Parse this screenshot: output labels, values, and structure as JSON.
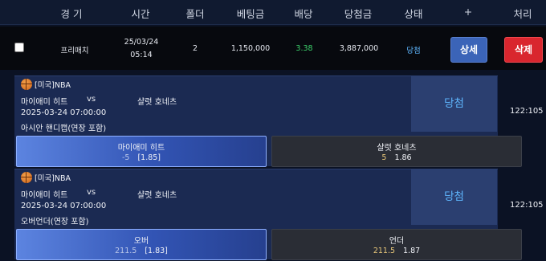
{
  "header": {
    "col_game": "경 기",
    "col_time": "시간",
    "col_folder": "폴더",
    "col_stake": "베팅금",
    "col_odds": "배당",
    "col_payout": "당첨금",
    "col_status": "상태",
    "col_plus": "+",
    "col_action": "처리"
  },
  "summary": {
    "game_type": "프리매치",
    "date": "25/03/24",
    "time": "05:14",
    "folder": "2",
    "stake": "1,150,000",
    "odds": "3.38",
    "payout": "3,887,000",
    "status": "당첨",
    "detail_button": "상세",
    "delete_button": "삭제"
  },
  "bets": [
    {
      "league": "[미국]NBA",
      "home": "마이애미 히트",
      "vs": "vs",
      "away": "샬럿 호네츠",
      "datetime": "2025-03-24 07:00:00",
      "market": "아시안 핸디캡(연장 포함)",
      "result": "당첨",
      "score": "122:105",
      "options": [
        {
          "name": "마이애미 히트",
          "line": "-5",
          "odds": "[1.85]",
          "selected": true
        },
        {
          "name": "샬럿 호네츠",
          "line": "5",
          "odds": "1.86",
          "selected": false
        }
      ]
    },
    {
      "league": "[미국]NBA",
      "home": "마이애미 히트",
      "vs": "vs",
      "away": "샬럿 호네츠",
      "datetime": "2025-03-24 07:00:00",
      "market": "오버언더(연장 포함)",
      "result": "당첨",
      "score": "122:105",
      "options": [
        {
          "name": "오버",
          "line": "211.5",
          "odds": "[1.83]",
          "selected": true
        },
        {
          "name": "언더",
          "line": "211.5",
          "odds": "1.87",
          "selected": false
        }
      ]
    }
  ],
  "colors": {
    "win_text": "#5fb7ff",
    "odds_green": "#3cd06a",
    "delete_red": "#d9262e",
    "detail_blue": "#3b64b8"
  },
  "icons": [
    "basketball-icon",
    "checkbox"
  ]
}
